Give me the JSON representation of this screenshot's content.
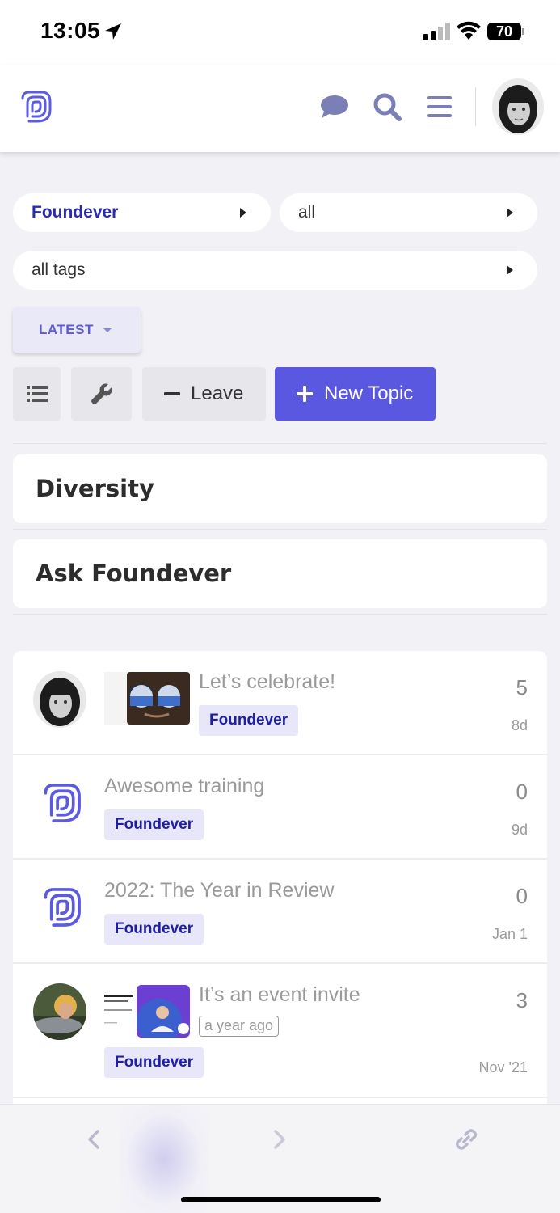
{
  "status_bar": {
    "time": "13:05",
    "battery": "70"
  },
  "filters": {
    "category": "Foundever",
    "subcategory": "all",
    "tags": "all tags"
  },
  "sort": {
    "label": "LATEST"
  },
  "actions": {
    "leave_label": "Leave",
    "new_topic_label": "New Topic"
  },
  "categories": [
    {
      "name": "Diversity"
    },
    {
      "name": "Ask Foundever"
    }
  ],
  "topics": [
    {
      "title": "Let’s celebrate!",
      "tag": "Foundever",
      "replies": "5",
      "date": "8d"
    },
    {
      "title": "Awesome training",
      "tag": "Foundever",
      "replies": "0",
      "date": "9d"
    },
    {
      "title": "2022: The Year in Review",
      "tag": "Foundever",
      "replies": "0",
      "date": "Jan 1"
    },
    {
      "title": "It’s an event invite",
      "tag": "Foundever",
      "replies": "3",
      "date": "Nov '21",
      "age_badge": "a year ago"
    }
  ],
  "colors": {
    "accent": "#5a58e0",
    "brand_logo": "#5c5be0",
    "tag_bg": "#e7e7f9",
    "tag_text": "#1f1fa5"
  }
}
